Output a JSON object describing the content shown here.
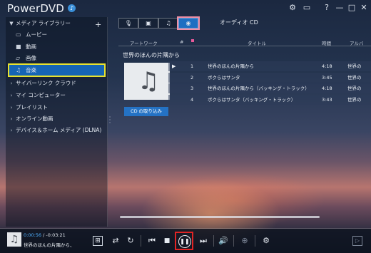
{
  "app": {
    "title": "PowerDVD",
    "notification_icon": "bell-icon"
  },
  "window_controls": {
    "settings": "⚙",
    "device": "▭",
    "help": "?",
    "minimize": "—",
    "restore": "□",
    "close": "✕"
  },
  "sidebar": {
    "media_library": "メディア ライブラリー",
    "add": "+",
    "sub_items": [
      {
        "icon": "movie-icon",
        "glyph": "▭",
        "label": "ムービー"
      },
      {
        "icon": "video-icon",
        "glyph": "■",
        "label": "動画"
      },
      {
        "icon": "photo-icon",
        "glyph": "▱",
        "label": "画像"
      },
      {
        "icon": "music-icon",
        "glyph": "♫",
        "label": "音楽"
      }
    ],
    "sections": [
      {
        "label": "サイバーリンク クラウド"
      },
      {
        "label": "マイ コンピューター"
      },
      {
        "label": "プレイリスト"
      },
      {
        "label": "オンライン動画"
      },
      {
        "label": "デバイス＆ホーム メディア (DLNA)"
      }
    ]
  },
  "source_tabs": [
    {
      "icon": "microphone-icon",
      "glyph": "🎙"
    },
    {
      "icon": "picture-icon",
      "glyph": "▣"
    },
    {
      "icon": "music-note-icon",
      "glyph": "♫"
    },
    {
      "icon": "disc-icon",
      "glyph": "◉"
    }
  ],
  "cd_title": "オーディオ CD",
  "columns": {
    "artwork": "アートワーク",
    "number": "#",
    "title": "タイトル",
    "duration": "時間",
    "album": "アルバ"
  },
  "album": {
    "name": "世界のほんの片隅から",
    "import_button": "CD の取り込み"
  },
  "tracks": [
    {
      "playing": "▶",
      "num": "1",
      "title": "世界のほんの片隅から",
      "time": "4:18",
      "album": "世界の"
    },
    {
      "playing": "",
      "num": "2",
      "title": "ボクらはサンタ",
      "time": "3:45",
      "album": "世界の"
    },
    {
      "playing": "",
      "num": "3",
      "title": "世界のほんの片隅から（バッキング・トラック）",
      "time": "4:18",
      "album": "世界の"
    },
    {
      "playing": "",
      "num": "4",
      "title": "ボクらはサンタ（バッキング・トラック）",
      "time": "3:43",
      "album": "世界の"
    }
  ],
  "player": {
    "elapsed": "0:00:56",
    "remaining": "/ -0:03:21",
    "now_playing": "世界のほんの片隅から、",
    "thumb_glyph": "♫"
  },
  "controls": {
    "scene": "⊞",
    "shuffle": "⇄",
    "repeat": "↻",
    "prev": "⏮",
    "stop": "■",
    "pause": "❚❚",
    "next": "⏭",
    "volume": "🔊",
    "zoom": "⊕",
    "settings": "⚙",
    "screen": "▷"
  }
}
